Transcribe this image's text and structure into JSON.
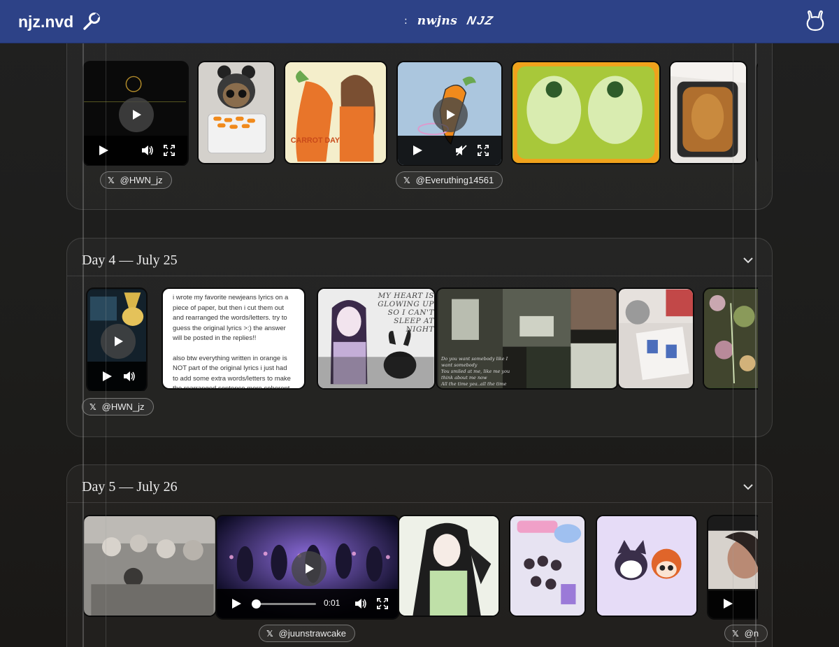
{
  "header": {
    "brand": "njz.nvd",
    "sep": ":",
    "logo_a": "nwjns",
    "logo_b": "NJZ",
    "icons": {
      "brand": "wrench-icon",
      "profile": "bunny-icon"
    }
  },
  "days": [
    {
      "title": "",
      "collapsed": false,
      "tags": [
        {
          "x": "𝕏",
          "handle": "@HWN_jz"
        },
        {
          "x": "𝕏",
          "handle": "@Everuthing14561"
        }
      ]
    },
    {
      "title": "Day 4 — July 25",
      "tags": [
        {
          "x": "𝕏",
          "handle": "@HWN_jz"
        }
      ],
      "text_post": [
        " i wrote my favorite newjeans lyrics on a piece of paper, but then i cut them out and rearranged the words/letters. try to guess the original lyrics >:) the answer will be posted in the replies!!",
        "also btw everything written in orange is NOT part of the original lyrics i just had to add some extra words/letters to make the rearranged sentence more coherent lmao"
      ],
      "art_text": "MY HEART IS GLOWING UP SO I CAN'T SLEEP AT NIGHT",
      "collage_lines": [
        "Do you want somebody like I",
        "want somebody",
        "You smiled at me, like me you",
        "think about me now",
        "All the time yea..all the time"
      ]
    },
    {
      "title": "Day 5 — July 26",
      "tags": [
        {
          "x": "𝕏",
          "handle": "@juunstrawcake"
        },
        {
          "x": "𝕏",
          "handle": "@n"
        }
      ],
      "video_time": "0:01",
      "video_progress": 0.05
    }
  ],
  "card_labels": {
    "carrot_day": "CARROT DAY"
  }
}
